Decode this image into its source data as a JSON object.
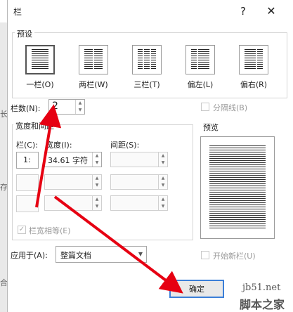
{
  "window": {
    "title": "栏",
    "help": "?",
    "close": "✕"
  },
  "presets": {
    "label": "预设",
    "items": [
      {
        "label": "一栏(O)",
        "selected": true
      },
      {
        "label": "两栏(W)",
        "selected": false
      },
      {
        "label": "三栏(T)",
        "selected": false
      },
      {
        "label": "偏左(L)",
        "selected": false
      },
      {
        "label": "偏右(R)",
        "selected": false
      }
    ]
  },
  "columns": {
    "label": "栏数(N):",
    "value": "2"
  },
  "line_between": {
    "label": "分隔线(B)",
    "checked": false
  },
  "width_spacing": {
    "label": "宽度和间距",
    "col_header": "栏(C):",
    "width_header": "宽度(I):",
    "spacing_header": "间距(S):",
    "rows": [
      {
        "col": "1:",
        "width": "34.61 字符",
        "spacing": ""
      },
      {
        "col": "",
        "width": "",
        "spacing": ""
      },
      {
        "col": "",
        "width": "",
        "spacing": ""
      }
    ]
  },
  "equal_width": {
    "label": "栏宽相等(E)",
    "checked": true
  },
  "preview": {
    "label": "预览"
  },
  "apply_to": {
    "label": "应用于(A):",
    "value": "整篇文档"
  },
  "start_new_column": {
    "label": "开始新栏(U)",
    "checked": false
  },
  "buttons": {
    "ok": "确定"
  },
  "background": {
    "items": [
      "长",
      "存",
      "合"
    ]
  },
  "watermark": {
    "site": "jb51.net",
    "brand": "脚本之家"
  },
  "colors": {
    "accent": "#e60012",
    "border": "#adadad",
    "disabled_text": "#9a9a9a"
  }
}
